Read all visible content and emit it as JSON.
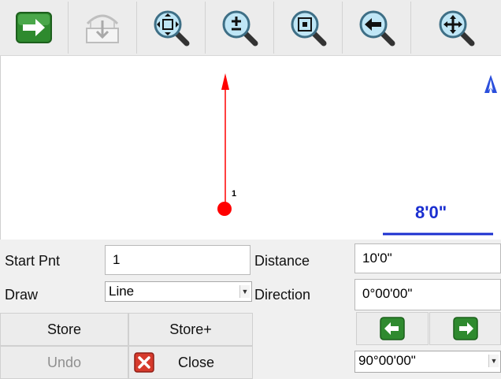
{
  "toolbar": {
    "buttons": [
      {
        "name": "go-forward-button",
        "icon": "green-right-arrow-icon"
      },
      {
        "name": "import-button",
        "icon": "download-tray-icon",
        "disabled": true
      },
      {
        "name": "zoom-fit-button",
        "icon": "zoom-fit-icon"
      },
      {
        "name": "zoom-in-out-button",
        "icon": "zoom-plus-minus-icon"
      },
      {
        "name": "zoom-window-button",
        "icon": "zoom-window-icon"
      },
      {
        "name": "zoom-previous-button",
        "icon": "zoom-previous-icon"
      },
      {
        "name": "pan-button",
        "icon": "pan-move-icon"
      }
    ]
  },
  "canvas": {
    "point_label": "1",
    "scale_label": "8'0\"",
    "north_symbol": "north-arrow-icon",
    "line_color": "#ff0000",
    "scale_color": "#1b2fd0"
  },
  "form": {
    "start_pnt_label": "Start Pnt",
    "start_pnt_value": "1",
    "distance_label": "Distance",
    "distance_value": "10'0\"",
    "draw_label": "Draw",
    "draw_value": "Line",
    "direction_label": "Direction",
    "direction_value": "0°00'00\"",
    "angle_value": "90°00'00\""
  },
  "actions": {
    "store": "Store",
    "store_plus": "Store+",
    "undo": "Undo",
    "close": "Close"
  }
}
